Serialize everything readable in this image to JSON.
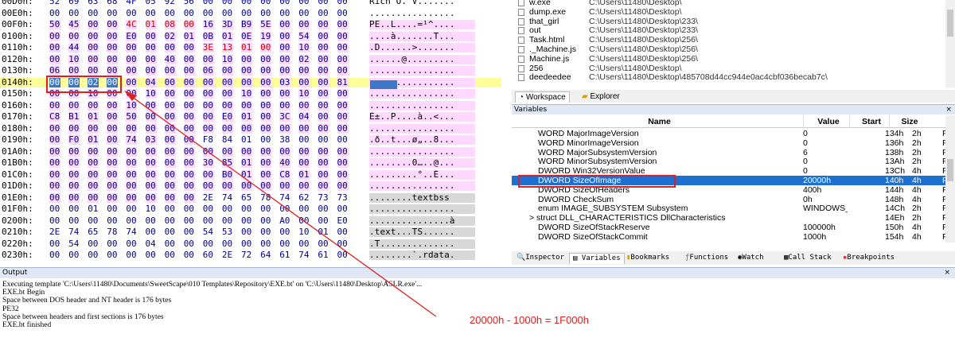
{
  "hex": {
    "rows": [
      {
        "addr": "00D0h:",
        "bytes": [
          "52",
          "69",
          "63",
          "68",
          "4F",
          "05",
          "92",
          "56",
          "00",
          "00",
          "00",
          "00",
          "00",
          "00",
          "00",
          "00"
        ],
        "pink": [],
        "red": [],
        "chars": "Rich O.'V.......",
        "cstyle": ""
      },
      {
        "addr": "00E0h:",
        "bytes": [
          "00",
          "00",
          "00",
          "00",
          "00",
          "00",
          "00",
          "00",
          "00",
          "00",
          "00",
          "00",
          "00",
          "00",
          "00",
          "00"
        ],
        "pink": [],
        "red": [],
        "chars": "................",
        "cstyle": ""
      },
      {
        "addr": "00F0h:",
        "bytes": [
          "50",
          "45",
          "00",
          "00",
          "4C",
          "01",
          "08",
          "00",
          "16",
          "3D",
          "B9",
          "5E",
          "00",
          "00",
          "00",
          "00"
        ],
        "pink": [
          0,
          1,
          2,
          3,
          4,
          5,
          6,
          7,
          8,
          9,
          10,
          11,
          12,
          13,
          14,
          15
        ],
        "red": [
          4,
          5,
          6,
          7
        ],
        "chars": "PE..L....=¹^....",
        "cstyle": "pk"
      },
      {
        "addr": "0100h:",
        "bytes": [
          "00",
          "00",
          "00",
          "00",
          "E0",
          "00",
          "02",
          "01",
          "0B",
          "01",
          "0E",
          "19",
          "00",
          "54",
          "00",
          "00"
        ],
        "pink": [
          0,
          1,
          2,
          3,
          4,
          5,
          6,
          7,
          8,
          9,
          10,
          11,
          12,
          13,
          14,
          15
        ],
        "red": [],
        "chars": "....à.......T...",
        "cstyle": "pk"
      },
      {
        "addr": "0110h:",
        "bytes": [
          "00",
          "44",
          "00",
          "00",
          "00",
          "00",
          "00",
          "00",
          "3E",
          "13",
          "01",
          "00",
          "00",
          "10",
          "00",
          "00"
        ],
        "pink": [
          0,
          1,
          2,
          3,
          4,
          5,
          6,
          7,
          8,
          9,
          10,
          11,
          12,
          13,
          14,
          15
        ],
        "red": [
          8,
          9,
          10,
          11
        ],
        "chars": ".D......>.......",
        "cstyle": "pk"
      },
      {
        "addr": "0120h:",
        "bytes": [
          "00",
          "10",
          "00",
          "00",
          "00",
          "00",
          "40",
          "00",
          "00",
          "10",
          "00",
          "00",
          "00",
          "02",
          "00",
          "00"
        ],
        "pink": [
          0,
          1,
          2,
          3,
          4,
          5,
          6,
          7,
          8,
          9,
          10,
          11,
          12,
          13,
          14,
          15
        ],
        "red": [],
        "chars": "......@.........",
        "cstyle": "pk"
      },
      {
        "addr": "0130h:",
        "bytes": [
          "06",
          "00",
          "00",
          "00",
          "00",
          "00",
          "00",
          "00",
          "06",
          "00",
          "00",
          "00",
          "00",
          "00",
          "00",
          "00"
        ],
        "pink": [
          0,
          1,
          2,
          3,
          4,
          5,
          6,
          7,
          8,
          9,
          10,
          11,
          12,
          13,
          14,
          15
        ],
        "red": [],
        "chars": "................",
        "cstyle": "pk"
      },
      {
        "addr": "0140h:",
        "bytes": [
          "00",
          "00",
          "02",
          "00",
          "00",
          "04",
          "00",
          "00",
          "00",
          "00",
          "00",
          "00",
          "03",
          "00",
          "00",
          "81"
        ],
        "pink": [
          4,
          5,
          6,
          7,
          8,
          9,
          10,
          11,
          12,
          13,
          14,
          15
        ],
        "red": [],
        "chars": ".... ...........",
        "cstyle": "pk",
        "sel": true
      },
      {
        "addr": "0150h:",
        "bytes": [
          "00",
          "00",
          "10",
          "00",
          "00",
          "10",
          "00",
          "00",
          "00",
          "00",
          "10",
          "00",
          "00",
          "10",
          "00",
          "00"
        ],
        "pink": [
          0,
          1,
          2,
          3,
          4,
          5,
          6,
          7,
          8,
          9,
          10,
          11,
          12,
          13,
          14,
          15
        ],
        "red": [],
        "chars": "................",
        "cstyle": "pk"
      },
      {
        "addr": "0160h:",
        "bytes": [
          "00",
          "00",
          "00",
          "00",
          "10",
          "00",
          "00",
          "00",
          "00",
          "00",
          "00",
          "00",
          "00",
          "00",
          "00",
          "00"
        ],
        "pink": [
          0,
          1,
          2,
          3,
          4,
          5,
          6,
          7,
          8,
          9,
          10,
          11,
          12,
          13,
          14,
          15
        ],
        "red": [],
        "chars": "................",
        "cstyle": "pk"
      },
      {
        "addr": "0170h:",
        "bytes": [
          "C8",
          "B1",
          "01",
          "00",
          "50",
          "00",
          "00",
          "00",
          "00",
          "E0",
          "01",
          "00",
          "3C",
          "04",
          "00",
          "00"
        ],
        "pink": [
          0,
          1,
          2,
          3,
          4,
          5,
          6,
          7,
          8,
          9,
          10,
          11,
          12,
          13,
          14,
          15
        ],
        "red": [],
        "chars": "È±..P....à..<...",
        "cstyle": "pk"
      },
      {
        "addr": "0180h:",
        "bytes": [
          "00",
          "00",
          "00",
          "00",
          "00",
          "00",
          "00",
          "00",
          "00",
          "00",
          "00",
          "00",
          "00",
          "00",
          "00",
          "00"
        ],
        "pink": [
          0,
          1,
          2,
          3,
          4,
          5,
          6,
          7,
          8,
          9,
          10,
          11,
          12,
          13,
          14,
          15
        ],
        "red": [],
        "chars": "................",
        "cstyle": "pk"
      },
      {
        "addr": "0190h:",
        "bytes": [
          "00",
          "F0",
          "01",
          "00",
          "74",
          "03",
          "00",
          "00",
          "F8",
          "84",
          "01",
          "00",
          "38",
          "00",
          "00",
          "00"
        ],
        "pink": [
          0,
          1,
          2,
          3,
          4,
          5,
          6,
          7
        ],
        "red": [],
        "chars": ".ð..t...ø„..8...",
        "cstyle": "pk"
      },
      {
        "addr": "01A0h:",
        "bytes": [
          "00",
          "00",
          "00",
          "00",
          "00",
          "00",
          "00",
          "00",
          "00",
          "00",
          "00",
          "00",
          "00",
          "00",
          "00",
          "00"
        ],
        "pink": [
          0,
          1,
          2,
          3,
          4,
          5,
          6,
          7,
          8,
          9,
          10,
          11,
          12,
          13,
          14,
          15
        ],
        "red": [],
        "chars": "................",
        "cstyle": "pk"
      },
      {
        "addr": "01B0h:",
        "bytes": [
          "00",
          "00",
          "00",
          "00",
          "00",
          "00",
          "00",
          "00",
          "30",
          "85",
          "01",
          "00",
          "40",
          "00",
          "00",
          "00"
        ],
        "pink": [
          0,
          1,
          2,
          3,
          4,
          5,
          6,
          7,
          8,
          9,
          10,
          11,
          12,
          13,
          14,
          15
        ],
        "red": [],
        "chars": "........0…..@...",
        "cstyle": "pk"
      },
      {
        "addr": "01C0h:",
        "bytes": [
          "00",
          "00",
          "00",
          "00",
          "00",
          "00",
          "00",
          "00",
          "00",
          "B0",
          "01",
          "00",
          "C8",
          "01",
          "00",
          "00"
        ],
        "pink": [
          0,
          1,
          2,
          3,
          4,
          5,
          6,
          7,
          8,
          9,
          10,
          11,
          12,
          13,
          14,
          15
        ],
        "red": [],
        "chars": ".........°..È...",
        "cstyle": "pk"
      },
      {
        "addr": "01D0h:",
        "bytes": [
          "00",
          "00",
          "00",
          "00",
          "00",
          "00",
          "00",
          "00",
          "00",
          "00",
          "00",
          "00",
          "00",
          "00",
          "00",
          "00"
        ],
        "pink": [
          0,
          1,
          2,
          3,
          4,
          5,
          6,
          7,
          8,
          9,
          10,
          11,
          12,
          13,
          14,
          15
        ],
        "red": [],
        "chars": "................",
        "cstyle": "pk"
      },
      {
        "addr": "01E0h:",
        "bytes": [
          "00",
          "00",
          "00",
          "00",
          "00",
          "00",
          "00",
          "00",
          "2E",
          "74",
          "65",
          "78",
          "74",
          "62",
          "73",
          "73"
        ],
        "pink": [
          0,
          1,
          2,
          3,
          4,
          5,
          6,
          7
        ],
        "red": [],
        "chars": "........textbss",
        "cstyle": "gr"
      },
      {
        "addr": "01F0h:",
        "bytes": [
          "00",
          "00",
          "01",
          "00",
          "00",
          "10",
          "00",
          "00",
          "00",
          "00",
          "00",
          "00",
          "00",
          "00",
          "00",
          "00"
        ],
        "pink": [],
        "red": [],
        "chars": "................",
        "cstyle": "gr"
      },
      {
        "addr": "0200h:",
        "bytes": [
          "00",
          "00",
          "00",
          "00",
          "00",
          "00",
          "00",
          "00",
          "00",
          "00",
          "00",
          "00",
          "A0",
          "00",
          "00",
          "E0"
        ],
        "pink": [],
        "red": [],
        "chars": "...............à",
        "cstyle": "gr"
      },
      {
        "addr": "0210h:",
        "bytes": [
          "2E",
          "74",
          "65",
          "78",
          "74",
          "00",
          "00",
          "00",
          "54",
          "53",
          "00",
          "00",
          "00",
          "10",
          "01",
          "00"
        ],
        "pink": [],
        "red": [],
        "chars": ".text...TS......",
        "cstyle": "gr"
      },
      {
        "addr": "0220h:",
        "bytes": [
          "00",
          "54",
          "00",
          "00",
          "00",
          "04",
          "00",
          "00",
          "00",
          "00",
          "00",
          "00",
          "00",
          "00",
          "00",
          "00"
        ],
        "pink": [],
        "red": [],
        "chars": ".T..............",
        "cstyle": "gr"
      },
      {
        "addr": "0230h:",
        "bytes": [
          "00",
          "00",
          "00",
          "00",
          "00",
          "00",
          "00",
          "00",
          "60",
          "2E",
          "72",
          "64",
          "61",
          "74",
          "61",
          "00"
        ],
        "pink": [],
        "red": [],
        "chars": "........`.rdata.",
        "cstyle": "gr"
      }
    ]
  },
  "files": [
    {
      "name": "w.exe",
      "path": "C:\\Users\\11480\\Desktop\\"
    },
    {
      "name": "dump.exe",
      "path": "C:\\Users\\11480\\Desktop\\"
    },
    {
      "name": "that_girl",
      "path": "C:\\Users\\11480\\Desktop\\233\\"
    },
    {
      "name": "out",
      "path": "C:\\Users\\11480\\Desktop\\233\\"
    },
    {
      "name": "Task.html",
      "path": "C:\\Users\\11480\\Desktop\\256\\"
    },
    {
      "name": "._Machine.js",
      "path": "C:\\Users\\11480\\Desktop\\256\\"
    },
    {
      "name": "Machine.js",
      "path": "C:\\Users\\11480\\Desktop\\256\\"
    },
    {
      "name": "256",
      "path": "C:\\Users\\11480\\Desktop\\"
    },
    {
      "name": "deedeedee",
      "path": "C:\\Users\\11480\\Desktop\\485708d44cc944e0ac4cbf036becab7c\\"
    }
  ],
  "tabs_top": {
    "workspace": "Workspace",
    "explorer": "Explorer"
  },
  "variables": {
    "title": "Variables",
    "close": "×",
    "headers": {
      "name": "Name",
      "value": "Value",
      "start": "Start",
      "size": "Size"
    },
    "rows": [
      {
        "name": "WORD MajorImageVersion",
        "value": "0",
        "start": "134h",
        "size": "2h",
        "cut": "F"
      },
      {
        "name": "WORD MinorImageVersion",
        "value": "0",
        "start": "136h",
        "size": "2h",
        "cut": "F"
      },
      {
        "name": "WORD MajorSubsystemVersion",
        "value": "6",
        "start": "138h",
        "size": "2h",
        "cut": "F"
      },
      {
        "name": "WORD MinorSubsystemVersion",
        "value": "0",
        "start": "13Ah",
        "size": "2h",
        "cut": "F"
      },
      {
        "name": "DWORD Win32VersionValue",
        "value": "0",
        "start": "13Ch",
        "size": "4h",
        "cut": "F"
      },
      {
        "name": "DWORD SizeOfImage",
        "value": "20000h",
        "start": "140h",
        "size": "4h",
        "cut": "F",
        "sel": true
      },
      {
        "name": "DWORD SizeOfHeaders",
        "value": "400h",
        "start": "144h",
        "size": "4h",
        "cut": "F"
      },
      {
        "name": "DWORD CheckSum",
        "value": "0h",
        "start": "148h",
        "size": "4h",
        "cut": "F"
      },
      {
        "name": "enum IMAGE_SUBSYSTEM Subsystem",
        "value": "WINDOWS_C...",
        "start": "14Ch",
        "size": "2h",
        "cut": "F"
      },
      {
        "name": "struct DLL_CHARACTERISTICS DllCharacteristics",
        "value": "",
        "start": "14Eh",
        "size": "2h",
        "cut": "F",
        "expand": true
      },
      {
        "name": "DWORD SizeOfStackReserve",
        "value": "100000h",
        "start": "150h",
        "size": "4h",
        "cut": "F"
      },
      {
        "name": "DWORD SizeOfStackCommit",
        "value": "1000h",
        "start": "154h",
        "size": "4h",
        "cut": "F"
      }
    ]
  },
  "tabs_bottom": {
    "inspector": "Inspector",
    "variables": "Variables",
    "bookmarks": "Bookmarks",
    "functions": "Functions",
    "watch": "Watch",
    "callstack": "Call Stack",
    "breakpoints": "Breakpoints"
  },
  "output": {
    "title": "Output",
    "close": "×",
    "lines": [
      "Executing template 'C:\\Users\\11480\\Documents\\SweetScape\\010 Templates\\Repository\\EXE.bt' on 'C:\\Users\\11480\\Desktop\\ASLR.exe'...",
      "EXE.bt Begin",
      "Space between DOS header and NT header is 176 bytes",
      "PE32",
      "Space between headers and first sections is 176 bytes",
      "EXE.bt finished"
    ]
  },
  "annotation": "20000h - 1000h = 1F000h",
  "colors": {
    "accent": "#1e6fd2",
    "annotation": "#e02020",
    "pink": "#ffd8ff"
  }
}
